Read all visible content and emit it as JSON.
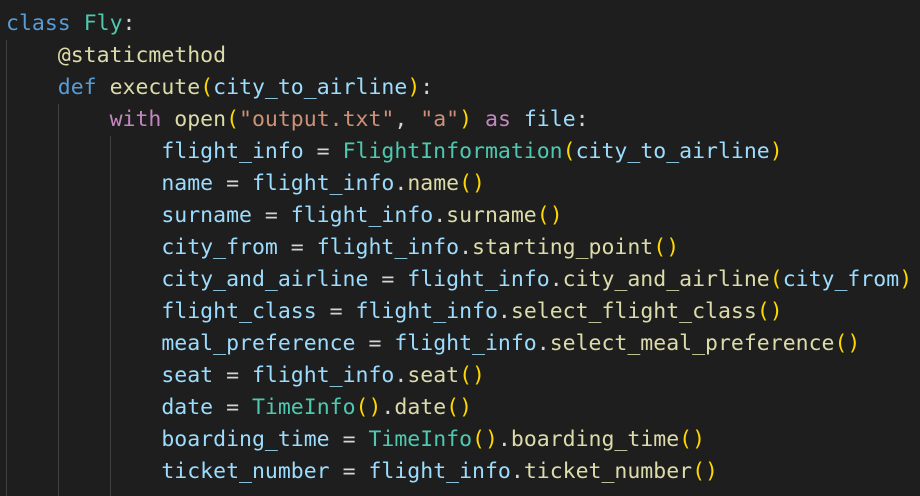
{
  "code": {
    "l1": {
      "kw": "class",
      "name": "Fly",
      "colon": ":"
    },
    "l2": {
      "decorator": "@staticmethod"
    },
    "l3": {
      "kw": "def",
      "fn": "execute",
      "open": "(",
      "param": "city_to_airline",
      "close": ")",
      "colon": ":"
    },
    "l4": {
      "kw": "with",
      "fn": "open",
      "open": "(",
      "arg1": "\"output.txt\"",
      "comma": ", ",
      "arg2": "\"a\"",
      "close": ")",
      "as": "as",
      "var": "file",
      "colon": ":"
    },
    "l5": {
      "var": "flight_info",
      "eq": " = ",
      "cls": "FlightInformation",
      "open": "(",
      "arg": "city_to_airline",
      "close": ")"
    },
    "l6": {
      "var": "name",
      "eq": " = ",
      "obj": "flight_info",
      "dot": ".",
      "method": "name",
      "parens": "()"
    },
    "l7": {
      "var": "surname",
      "eq": " = ",
      "obj": "flight_info",
      "dot": ".",
      "method": "surname",
      "parens": "()"
    },
    "l8": {
      "var": "city_from",
      "eq": " = ",
      "obj": "flight_info",
      "dot": ".",
      "method": "starting_point",
      "parens": "()"
    },
    "l9": {
      "var": "city_and_airline",
      "eq": " = ",
      "obj": "flight_info",
      "dot": ".",
      "method": "city_and_airline",
      "open": "(",
      "arg": "city_from",
      "close": ")"
    },
    "l10": {
      "var": "flight_class",
      "eq": " = ",
      "obj": "flight_info",
      "dot": ".",
      "method": "select_flight_class",
      "parens": "()"
    },
    "l11": {
      "var": "meal_preference",
      "eq": " = ",
      "obj": "flight_info",
      "dot": ".",
      "method": "select_meal_preference",
      "parens": "()"
    },
    "l12": {
      "var": "seat",
      "eq": " = ",
      "obj": "flight_info",
      "dot": ".",
      "method": "seat",
      "parens": "()"
    },
    "l13": {
      "var": "date",
      "eq": " = ",
      "cls": "TimeInfo",
      "parens1": "()",
      "dot": ".",
      "method": "date",
      "parens2": "()"
    },
    "l14": {
      "var": "boarding_time",
      "eq": " = ",
      "cls": "TimeInfo",
      "parens1": "()",
      "dot": ".",
      "method": "boarding_time",
      "parens2": "()"
    },
    "l15": {
      "var": "ticket_number",
      "eq": " = ",
      "obj": "flight_info",
      "dot": ".",
      "method": "ticket_number",
      "parens": "()"
    }
  }
}
